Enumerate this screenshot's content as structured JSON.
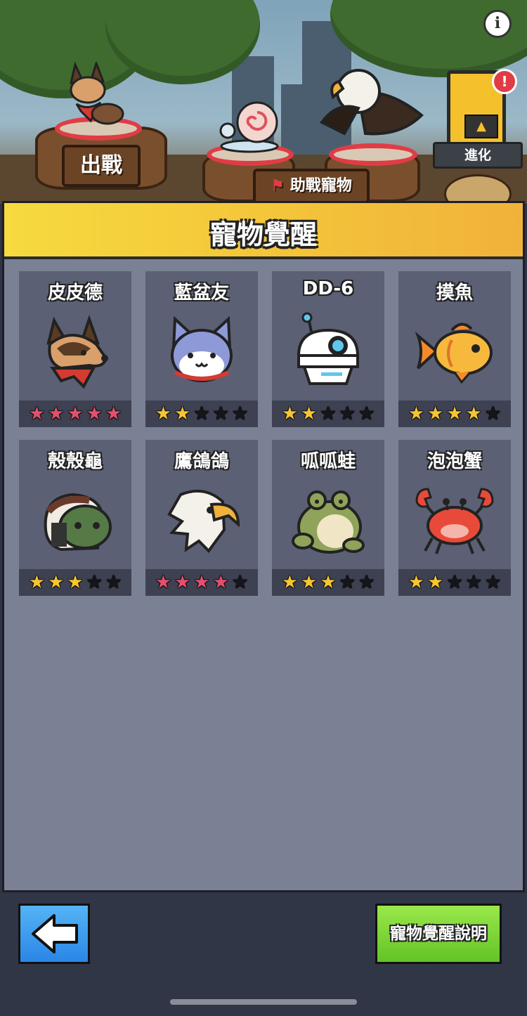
{
  "scene": {
    "deploy_sign": "出戰",
    "support_sign": "助戰寵物",
    "evolve_label": "進化",
    "info_icon": "info-icon",
    "alert_icon": "!"
  },
  "panel": {
    "title": "寵物覺醒"
  },
  "pets": [
    {
      "name": "皮皮德",
      "stars_filled": 5,
      "star_color": "#e2506e",
      "icon": "dog-icon"
    },
    {
      "name": "藍盆友",
      "stars_filled": 2,
      "star_color": "#f6c533",
      "icon": "cat-icon"
    },
    {
      "name": "DD-6",
      "stars_filled": 2,
      "star_color": "#f6c533",
      "icon": "robot-icon"
    },
    {
      "name": "摸魚",
      "stars_filled": 4,
      "star_color": "#f6c533",
      "icon": "goldfish-icon"
    },
    {
      "name": "殼殼龜",
      "stars_filled": 3,
      "star_color": "#f6c533",
      "icon": "turtle-icon"
    },
    {
      "name": "鷹鴿鴿",
      "stars_filled": 4,
      "star_color": "#e2506e",
      "icon": "eagle-icon"
    },
    {
      "name": "呱呱蛙",
      "stars_filled": 3,
      "star_color": "#f6c533",
      "icon": "frog-icon"
    },
    {
      "name": "泡泡蟹",
      "stars_filled": 2,
      "star_color": "#f6c533",
      "icon": "crab-icon"
    }
  ],
  "stars_total": 5,
  "bottom": {
    "back_icon": "back-arrow-icon",
    "help_label": "寵物覺醒說明"
  }
}
